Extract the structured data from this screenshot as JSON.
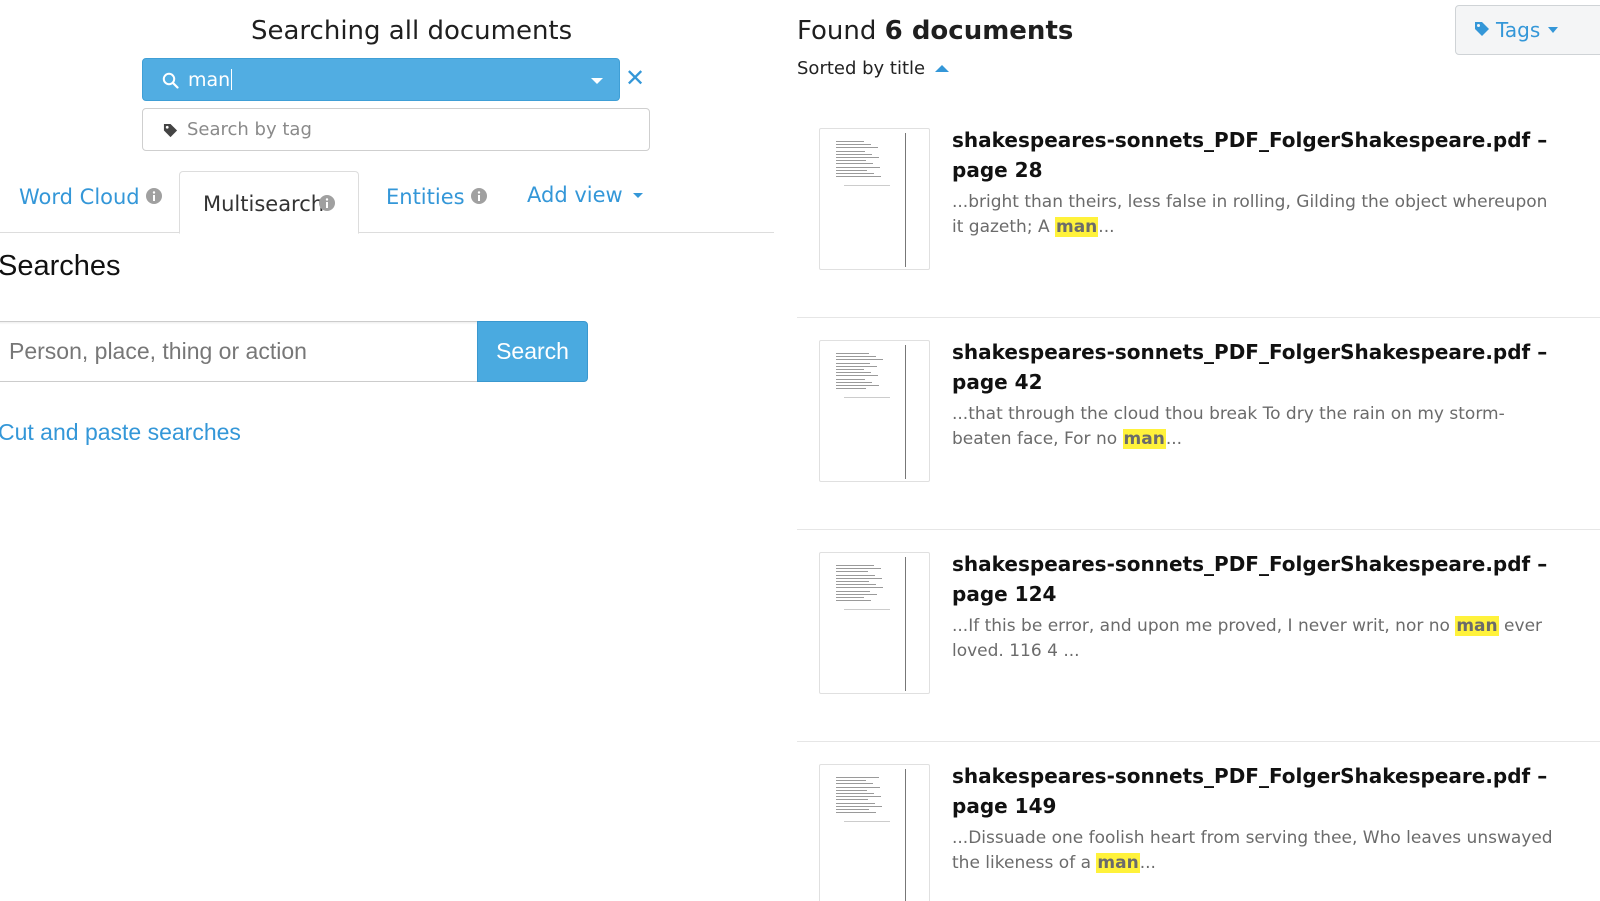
{
  "header": {
    "search_title": "Searching all documents",
    "query": "man",
    "tag_placeholder": "Search by tag"
  },
  "tabs": [
    {
      "label": "Word Cloud"
    },
    {
      "label": "Multisearch",
      "active": true
    },
    {
      "label": "Entities"
    },
    {
      "label": "Add view"
    }
  ],
  "multisearch": {
    "heading": "Searches",
    "input_placeholder": "Person, place, thing or action",
    "search_button": "Search",
    "cut_paste_link": "Cut and paste searches"
  },
  "results": {
    "found_prefix": "Found",
    "found_count": "6 documents",
    "sorted_label": "Sorted by title",
    "tags_button": "Tags",
    "items": [
      {
        "title": "shakespeares-sonnets_PDF_FolgerShakespeare.pdf – page 28",
        "snippet_before": "...bright than theirs, less false in rolling, Gilding the object whereupon it gazeth; A ",
        "highlight": "man",
        "snippet_after": "..."
      },
      {
        "title": "shakespeares-sonnets_PDF_FolgerShakespeare.pdf – page 42",
        "snippet_before": "...that through the cloud thou break To dry the rain on my storm-beaten face, For no ",
        "highlight": "man",
        "snippet_after": "..."
      },
      {
        "title": "shakespeares-sonnets_PDF_FolgerShakespeare.pdf – page 124",
        "snippet_before": "...If this be error, and upon me proved, I never writ, nor no ",
        "highlight": "man",
        "snippet_after": " ever loved. 116 4 ..."
      },
      {
        "title": "shakespeares-sonnets_PDF_FolgerShakespeare.pdf – page 149",
        "snippet_before": "...Dissuade one foolish heart from serving thee, Who leaves unswayed the likeness of a ",
        "highlight": "man",
        "snippet_after": "..."
      }
    ]
  },
  "colors": {
    "accent": "#3497d8",
    "query_bg": "#51ade2",
    "highlight": "#fff23b"
  },
  "icons": [
    "search-icon",
    "dropdown-caret-icon",
    "clear-icon",
    "tag-icon",
    "info-icon",
    "sort-ascending-icon",
    "document-thumbnail"
  ]
}
